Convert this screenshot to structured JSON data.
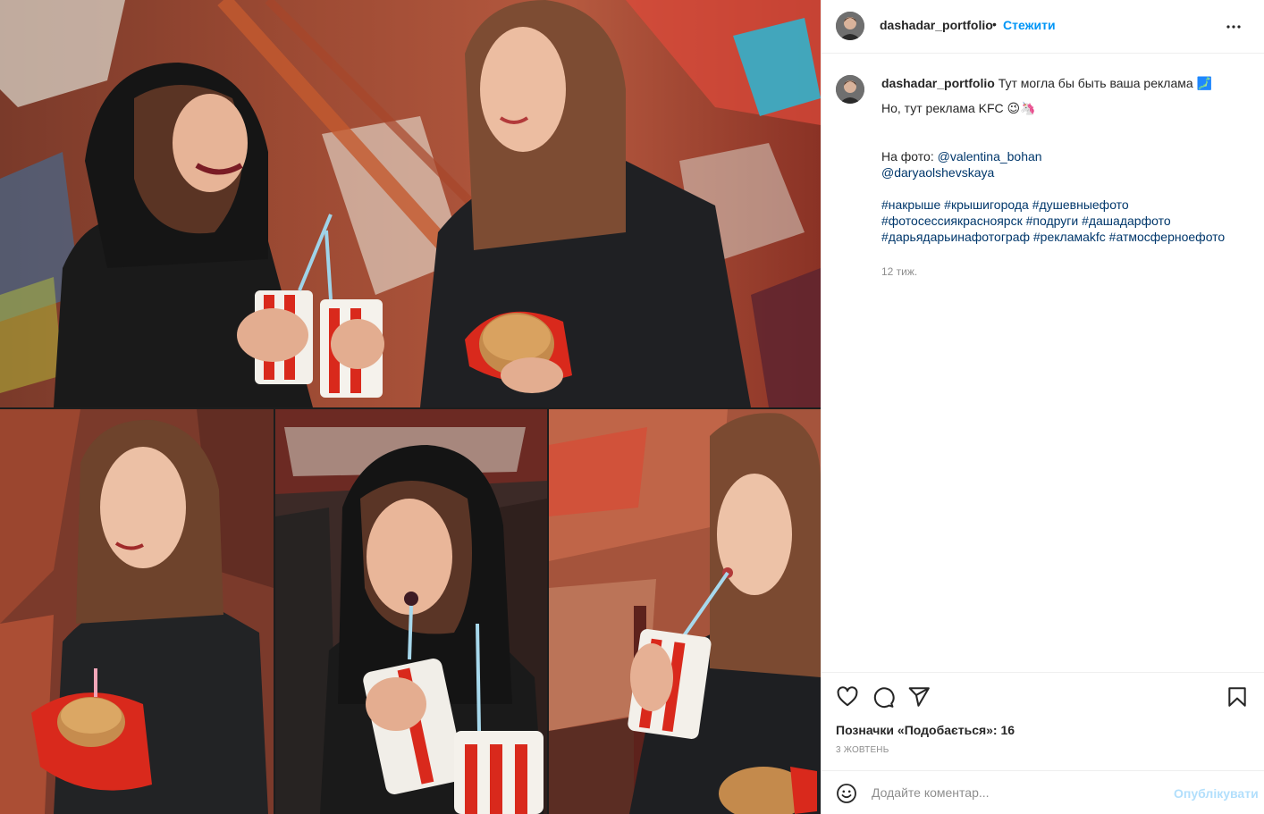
{
  "header": {
    "username": "dashadar_portfolio",
    "separator": "•",
    "follow_label": "Стежити"
  },
  "caption": {
    "username": "dashadar_portfolio",
    "line1": "Тут могла бы быть ваша реклама 🗾",
    "line2": "Но, тут реклама KFC 😉🦄",
    "photo_prefix": "На фото: ",
    "mention1": "@valentina_bohan",
    "mention2": "@daryaolshevskaya",
    "hashtags_line1": "#накрыше #крышигорода #душевныефото",
    "hashtags_line2": "#фотосессиякрасноярск #подруги #дашадарфото",
    "hashtags_line3": "#дарьядарьинафотограф #рекламаkfc #атмосферноефото",
    "time_ago": "12 тиж."
  },
  "actions": {
    "likes_text": "Позначки «Подобається»: 16",
    "date": "3 жовтень"
  },
  "comment": {
    "placeholder": "Додайте коментар...",
    "publish_label": "Опублікувати"
  },
  "icons": {
    "like": "heart-icon",
    "comment": "speech-bubble-icon",
    "share": "paper-plane-icon",
    "save": "bookmark-icon",
    "more": "more-horizontal-icon",
    "emoji": "smiley-icon"
  },
  "colors": {
    "link_blue": "#0095f6",
    "mention_blue": "#00376b",
    "publish_disabled": "#b2dffc",
    "secondary_text": "#8e8e8e",
    "kfc_red": "#d9291c"
  }
}
